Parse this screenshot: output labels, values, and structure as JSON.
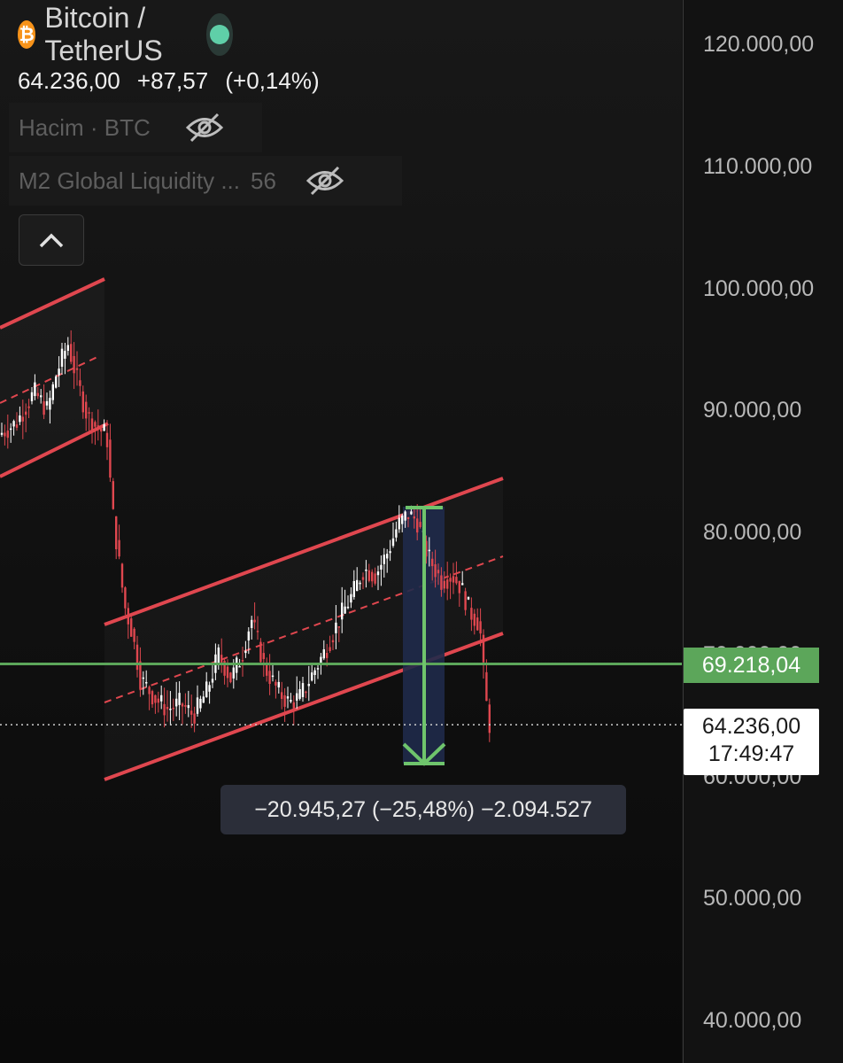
{
  "symbol": {
    "icon": "bitcoin-icon",
    "icon_glyph": "₿",
    "name": "Bitcoin / TetherUS",
    "status_color": "#5fcfa8"
  },
  "quote": {
    "price": "64.236,00",
    "change": "+87,57",
    "change_pct": "(+0,14%)"
  },
  "indicators": [
    {
      "name": "Hacim · BTC",
      "value": "",
      "icon": "eye-off-icon"
    },
    {
      "name": "M2 Global Liquidity ...",
      "value": "56",
      "icon": "eye-off-icon"
    }
  ],
  "collapse_icon": "chevron-up-icon",
  "price_axis": {
    "labels": [
      "120.000,00",
      "110.000,00",
      "100.000,00",
      "90.000,00",
      "80.000,00",
      "70.000,00",
      "60.000,00",
      "50.000,00",
      "40.000,00"
    ],
    "values": [
      120000,
      110000,
      100000,
      90000,
      80000,
      70000,
      60000,
      50000,
      40000
    ]
  },
  "horizontal_line": {
    "label": "69.218,04",
    "value": 69218.04,
    "color": "#5ca65a"
  },
  "last_price": {
    "label": "64.236,00",
    "countdown": "17:49:47",
    "value": 64236
  },
  "measure": {
    "text": "−20.945,27 (−25,48%) −2.094.527",
    "from": 82200,
    "to": 61255
  },
  "colors": {
    "channel": "#e0474f",
    "bull_candle": "#ffffff",
    "bear_candle": "#e0474f",
    "measure_fill": "#1f2a4a"
  }
}
